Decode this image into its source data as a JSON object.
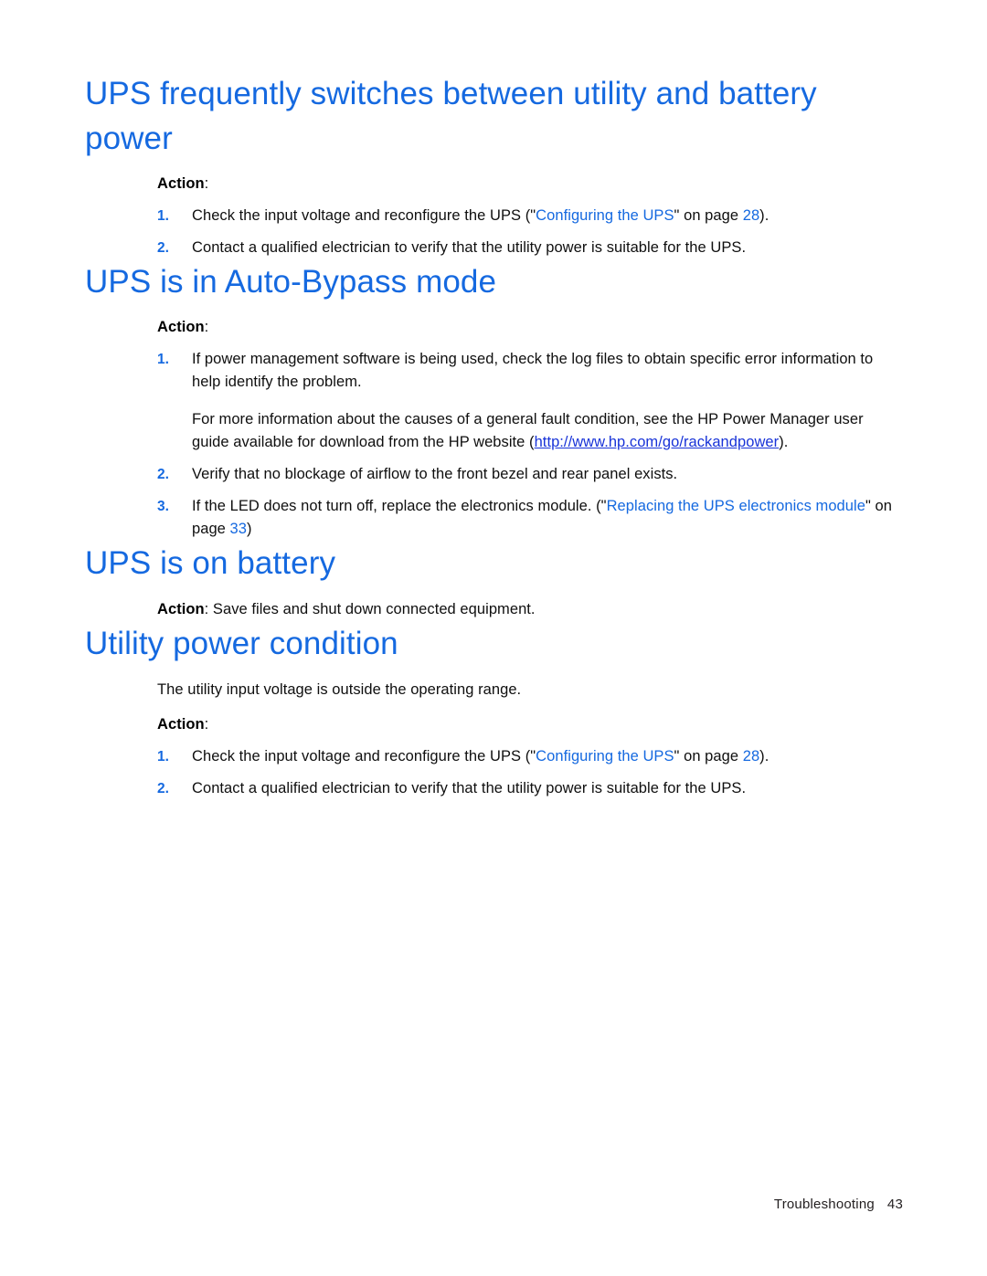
{
  "document": {
    "footer": {
      "chapter": "Troubleshooting",
      "page_number": "43"
    },
    "labels": {
      "action": "Action",
      "action_colon": ":"
    },
    "sections": [
      {
        "id": "ups-frequently-switches",
        "heading": "UPS frequently switches between utility and battery power",
        "action_heading": "Action:",
        "steps": [
          {
            "number": "1.",
            "text_before": "Check the input voltage and reconfigure the UPS (\"",
            "xref": "Configuring the UPS",
            "text_middle": "\" on page ",
            "pagenum": "28",
            "text_after": ")."
          },
          {
            "number": "2.",
            "text_before": "Contact a qualified electrician to verify that the utility power is suitable for the UPS.",
            "xref": "",
            "text_middle": "",
            "pagenum": "",
            "text_after": ""
          }
        ]
      },
      {
        "id": "ups-auto-bypass",
        "heading": "UPS is in Auto-Bypass mode",
        "action_heading": "Action:",
        "steps": [
          {
            "number": "1.",
            "text_before": "If power management software is being used, check the log files to obtain specific error information to help identify the problem.",
            "sub_paragraph_before": "For more information about the causes of a general fault condition, see the HP Power Manager user guide available for download from the HP website (",
            "sub_paragraph_link": "http://www.hp.com/go/rackandpower",
            "sub_paragraph_after": ")."
          },
          {
            "number": "2.",
            "text_before": "Verify that no blockage of airflow to the front bezel and rear panel exists."
          },
          {
            "number": "3.",
            "text_before": "If the LED does not turn off, replace the electronics module. (\"",
            "xref": "Replacing the UPS electronics module",
            "text_middle": "\" on page ",
            "pagenum": "33",
            "text_after": ")"
          }
        ]
      },
      {
        "id": "ups-on-battery",
        "heading": "UPS is on battery",
        "inline_action_label": "Action",
        "inline_action_text": ": Save files and shut down connected equipment."
      },
      {
        "id": "utility-power-condition",
        "heading": "Utility power condition",
        "lead": "The utility input voltage is outside the operating range.",
        "action_heading": "Action:",
        "steps": [
          {
            "number": "1.",
            "text_before": "Check the input voltage and reconfigure the UPS (\"",
            "xref": "Configuring the UPS",
            "text_middle": "\" on page ",
            "pagenum": "28",
            "text_after": ")."
          },
          {
            "number": "2.",
            "text_before": "Contact a qualified electrician to verify that the utility power is suitable for the UPS."
          }
        ]
      }
    ],
    "colors": {
      "heading_blue": "#1569E0",
      "link_blue": "#1569E0",
      "weblink_blue": "#1833D8",
      "body_text": "#0f0f0f",
      "page_background": "#ffffff"
    }
  }
}
